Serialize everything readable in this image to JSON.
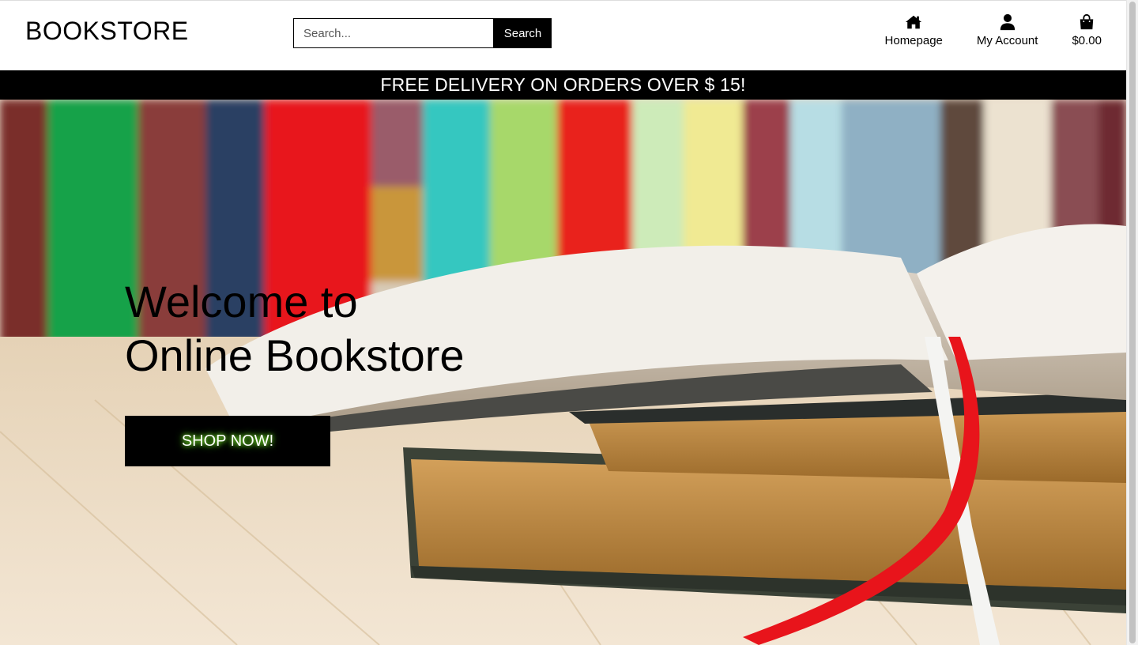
{
  "header": {
    "logo": "BOOKSTORE",
    "search": {
      "placeholder": "Search...",
      "button_label": "Search"
    },
    "nav": {
      "home": {
        "label": "Homepage",
        "icon": "home-icon"
      },
      "account": {
        "label": "My Account",
        "icon": "user-icon"
      },
      "cart": {
        "label": "$0.00",
        "icon": "shopping-bag-icon"
      }
    }
  },
  "banner": {
    "text": "FREE DELIVERY ON ORDERS OVER $ 15!"
  },
  "hero": {
    "title_line1": "Welcome to",
    "title_line2": "Online Bookstore",
    "cta_label": "SHOP NOW!"
  },
  "colors": {
    "brand": "#000000",
    "cta_glow": "#8dff3a",
    "bookmark": "#e8141b"
  }
}
